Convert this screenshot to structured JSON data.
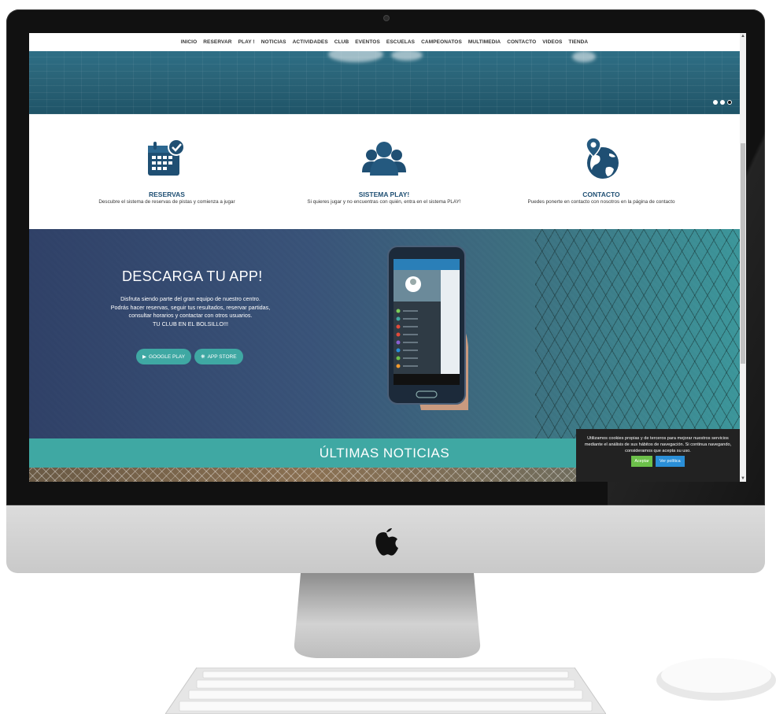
{
  "nav": {
    "items": [
      "INICIO",
      "RESERVAR",
      "PLAY !",
      "NOTICIAS",
      "ACTIVIDADES",
      "CLUB",
      "EVENTOS",
      "ESCUELAS",
      "CAMPEONATOS",
      "MULTIMEDIA",
      "CONTACTO",
      "VIDEOS",
      "TIENDA"
    ]
  },
  "features": [
    {
      "icon": "calendar-check-icon",
      "title": "RESERVAS",
      "text": "Descubre el sistema de reservas de pistas y comienza a jugar"
    },
    {
      "icon": "users-group-icon",
      "title": "SISTEMA PLAY!",
      "text": "Si quieres jugar y no encuentras con quién, entra en el sistema PLAY!"
    },
    {
      "icon": "globe-location-icon",
      "title": "CONTACTO",
      "text": "Puedes ponerte en contacto con nosotros en la página de contacto"
    }
  ],
  "app": {
    "title": "DESCARGA TU APP!",
    "lines": [
      "Disfruta siendo parte del gran equipo de nuestro centro.",
      "Podrás hacer reservas, seguir tus resultados, reservar partidas,",
      "consultar horarios y contactar con otros usuarios.",
      "TU CLUB EN EL BOLSILLO!!!"
    ],
    "google_play": "GOOGLE PLAY",
    "app_store": "APP STORE"
  },
  "news": {
    "title": "ÚLTIMAS NOTICIAS"
  },
  "cookie": {
    "text": "Utilizamos cookies propias y de terceros para mejorar nuestros servicios mediante el análisis de sus hábitos de navegación. Si continua navegando, consideramos que acepta su uso.",
    "accept": "Aceptar",
    "policy": "Ver política"
  },
  "colors": {
    "accent": "#3fa8a3",
    "heading": "#1f4f73"
  }
}
